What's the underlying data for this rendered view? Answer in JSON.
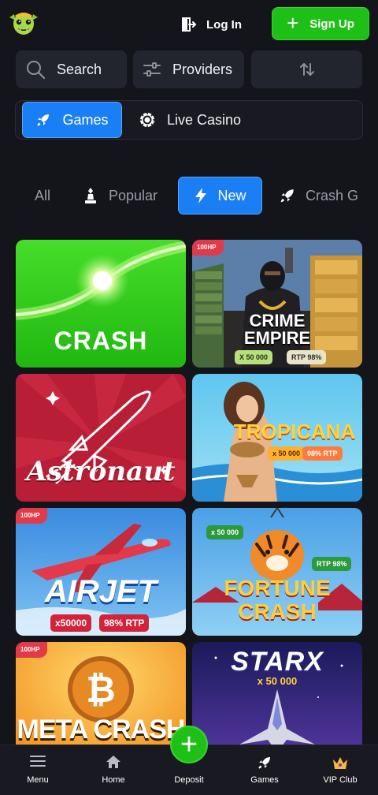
{
  "header": {
    "login_label": "Log In",
    "signup_label": "Sign Up"
  },
  "filters": {
    "search_label": "Search",
    "providers_label": "Providers"
  },
  "categories": {
    "games_label": "Games",
    "live_label": "Live Casino"
  },
  "tabs": {
    "all": "All",
    "popular": "Popular",
    "new": "New",
    "crash": "Crash G",
    "active": "New"
  },
  "games": [
    {
      "title": "CRASH"
    },
    {
      "title_line1": "CRIME",
      "title_line2": "EMPIRE",
      "badge": "100HP",
      "multiplier": "X 50 000",
      "rtp": "RTP 98%"
    },
    {
      "title": "Astronaut"
    },
    {
      "title": "TROPICANA",
      "multiplier": "x 50 000",
      "rtp": "98% RTP"
    },
    {
      "title": "AIRJET",
      "badge": "100HP",
      "multiplier": "x50000",
      "rtp": "98% RTP"
    },
    {
      "title_line1": "FORTUNE",
      "title_line2": "CRASH",
      "multiplier": "x 50 000",
      "rtp": "RTP 98%"
    },
    {
      "title": "META CRASH",
      "badge": "100HP"
    },
    {
      "title": "STARX",
      "multiplier": "x 50 000"
    }
  ],
  "bottom_nav": {
    "menu": "Menu",
    "home": "Home",
    "deposit": "Deposit",
    "games": "Games",
    "vip": "VIP Club"
  },
  "colors": {
    "background": "#14151b",
    "panel": "#23252e",
    "accent_blue": "#1a7ef5",
    "accent_green": "#1ec017"
  }
}
